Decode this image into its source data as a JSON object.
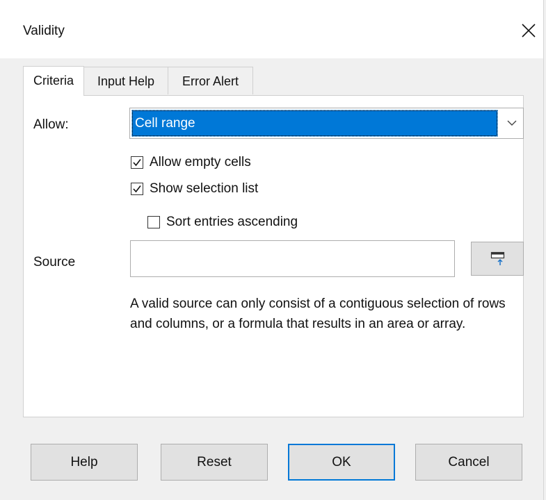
{
  "window": {
    "title": "Validity",
    "close_icon": "close-icon"
  },
  "tabs": [
    {
      "label": "Criteria",
      "active": true
    },
    {
      "label": "Input Help",
      "active": false
    },
    {
      "label": "Error Alert",
      "active": false
    }
  ],
  "criteria": {
    "allow_label": "Allow:",
    "allow_value": "Cell range",
    "checkboxes": {
      "allow_empty": {
        "label": "Allow empty cells",
        "checked": true
      },
      "show_list": {
        "label": "Show selection list",
        "checked": true
      },
      "sort_asc": {
        "label": "Sort entries ascending",
        "checked": false
      }
    },
    "source_label": "Source",
    "source_value": "",
    "shrink_icon": "shrink-icon",
    "hint": "A valid source can only consist of a contiguous selection of rows and columns, or a formula that results in an area or array."
  },
  "buttons": {
    "help": "Help",
    "reset": "Reset",
    "ok": "OK",
    "cancel": "Cancel"
  },
  "colors": {
    "accent": "#0078d7",
    "panel_bg": "#ffffff",
    "dialog_bg": "#f0f0f0"
  }
}
